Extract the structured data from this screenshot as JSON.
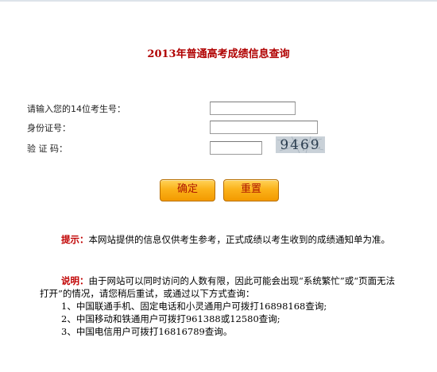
{
  "title": "2013年普通高考成绩信息查询",
  "form": {
    "exam_number_label": "请输入您的14位考生号：",
    "exam_number_value": "",
    "id_number_label": "身份证号：",
    "id_number_value": "",
    "verify_label": "验 证 码：",
    "verify_value": "",
    "captcha_code": "9469"
  },
  "buttons": {
    "submit_label": "确定",
    "reset_label": "重置"
  },
  "notes": {
    "tip_label": "提示：",
    "tip_text": "本网站提供的信息仅供考生参考，正式成绩以考生收到的成绩通知单为准。",
    "explain_label": "说明：",
    "explain_text": "由于网站可以同时访问的人数有限，因此可能会出现“系统繁忙”或“页面无法打开”的情况，请您稍后重试，或通过以下方式查询：",
    "items": [
      "1、中国联通手机、固定电话和小灵通用户可拨打16898168查询;",
      "2、中国移动和铁通用户可拨打961388或12580查询;",
      "3、中国电信用户可拨打16816789查询。"
    ]
  },
  "colors": {
    "title": "#b00000",
    "highlight": "#c00000",
    "button_top": "#ffd35a",
    "button_bottom": "#f39a00"
  }
}
